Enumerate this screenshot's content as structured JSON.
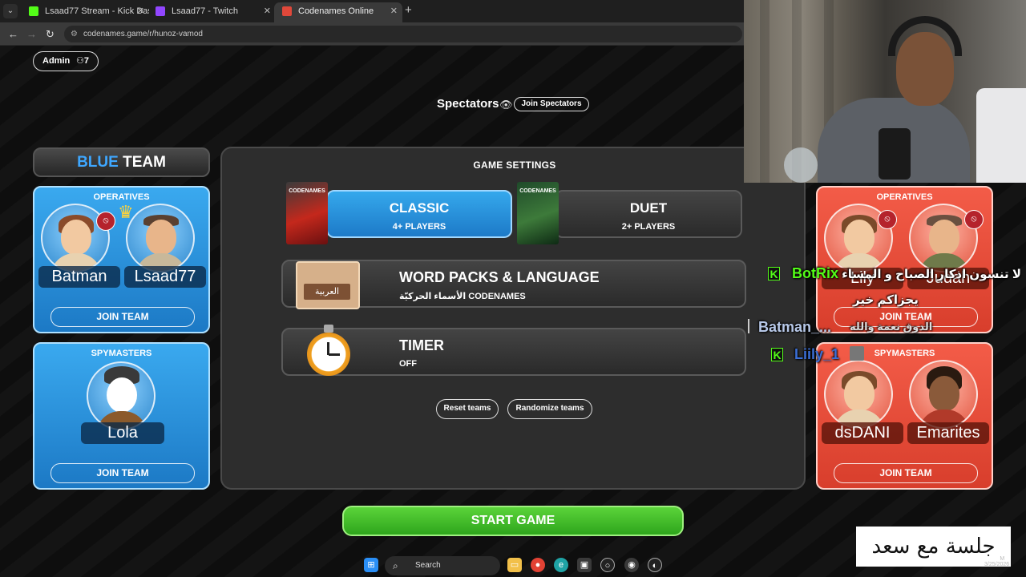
{
  "browser": {
    "tabs": [
      {
        "title": "Lsaad77 Stream - Kick Dashboar",
        "color": "#53fc18"
      },
      {
        "title": "Lsaad77 - Twitch",
        "color": "#9146ff"
      },
      {
        "title": "Codenames Online",
        "color": "#e0483a"
      }
    ],
    "url": "codenames.game/r/hunoz-vamod"
  },
  "game": {
    "admin_label": "Admin",
    "player_count": "7",
    "spectators_label": "Spectators",
    "join_spectators": "Join Spectators",
    "blue_team": {
      "title_color_word": "BLUE",
      "title_rest": "TEAM",
      "operatives_label": "OPERATIVES",
      "operatives": [
        "Batman",
        "Lsaad77"
      ],
      "spymasters_label": "SPYMASTERS",
      "spymasters": [
        "Lola"
      ],
      "join_team": "JOIN TEAM",
      "join_team_2": "JOIN TEAM"
    },
    "red_team": {
      "operatives_label": "OPERATIVES",
      "operatives": [
        "Lily",
        "Judah"
      ],
      "spymasters_label": "SPYMASTERS",
      "spymasters": [
        "dsDANI",
        "Emarites"
      ],
      "join_team": "JOIN TEAM",
      "join_team_2": "JOIN TEAM"
    },
    "settings": {
      "title": "GAME SETTINGS",
      "classic": {
        "title": "CLASSIC",
        "sub": "4+ PLAYERS",
        "box_label": "CODENAMES"
      },
      "duet": {
        "title": "DUET",
        "sub": "2+ PLAYERS",
        "box_label": "CODENAMES"
      },
      "word_packs": {
        "title": "WORD PACKS & LANGUAGE",
        "sub": "الأسماء الحركيّة CODENAMES",
        "card_label": "العربية"
      },
      "timer": {
        "title": "TIMER",
        "sub": "OFF"
      },
      "reset_teams": "Reset teams",
      "randomize_teams": "Randomize teams"
    },
    "start_game": "START GAME"
  },
  "chat": {
    "line1_user": "BotRix",
    "line1_msg": "لا تنسون اذكار الصباح و المساء",
    "line1_msg2": "يجزاكم خير",
    "line2_user": "Batman_...",
    "line2_msg": "الدوق نعمة والله",
    "line3_user": "Liily_1"
  },
  "overlay": {
    "watermark": "جلسة مع سعد",
    "date": "3/25/2026",
    "time_suffix": "M"
  },
  "taskbar": {
    "search": "Search"
  }
}
